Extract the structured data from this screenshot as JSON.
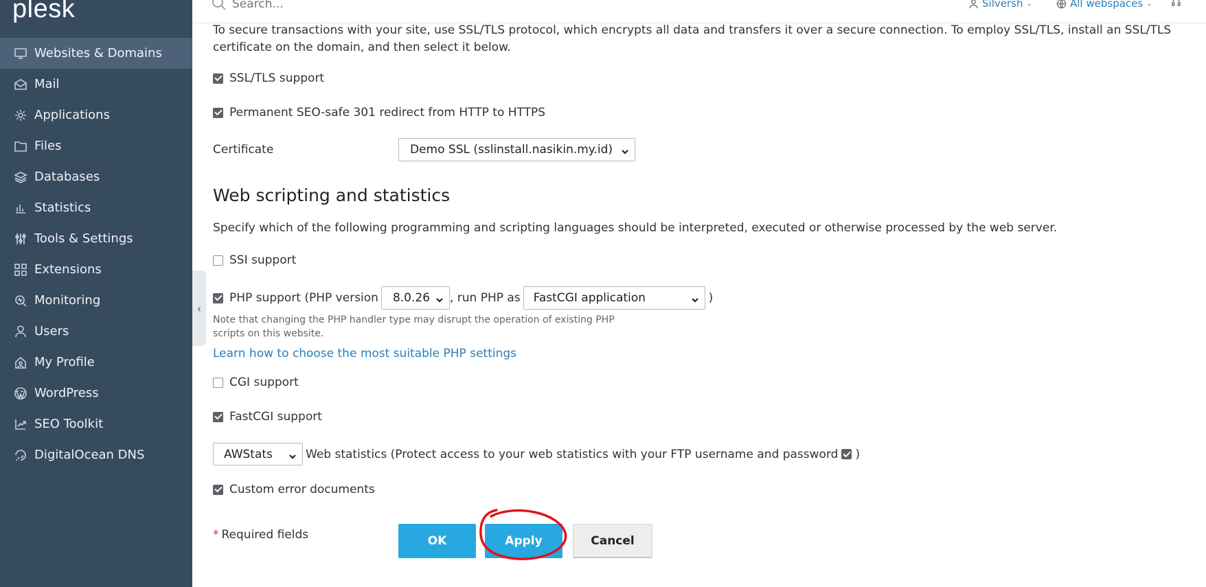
{
  "app": {
    "logo": "plesk"
  },
  "sidebar": {
    "items": [
      {
        "label": "Websites & Domains",
        "icon": "monitor-icon",
        "active": true
      },
      {
        "label": "Mail",
        "icon": "mail-icon"
      },
      {
        "label": "Applications",
        "icon": "gear-icon"
      },
      {
        "label": "Files",
        "icon": "folder-icon"
      },
      {
        "label": "Databases",
        "icon": "database-layers-icon"
      },
      {
        "label": "Statistics",
        "icon": "bar-chart-icon"
      },
      {
        "label": "Tools & Settings",
        "icon": "sliders-icon"
      },
      {
        "label": "Extensions",
        "icon": "extensions-grid-icon"
      },
      {
        "label": "Monitoring",
        "icon": "monitoring-icon"
      },
      {
        "label": "Users",
        "icon": "user-icon"
      },
      {
        "label": "My Profile",
        "icon": "profile-icon"
      },
      {
        "label": "WordPress",
        "icon": "wordpress-icon"
      },
      {
        "label": "SEO Toolkit",
        "icon": "seo-chart-icon"
      },
      {
        "label": "DigitalOcean DNS",
        "icon": "digitalocean-icon"
      }
    ]
  },
  "header": {
    "search_placeholder": "Search...",
    "user": "Silversh",
    "workspaces": "All webspaces"
  },
  "form": {
    "ssl_intro": "To secure transactions with your site, use SSL/TLS protocol, which encrypts all data and transfers it over a secure connection. To employ SSL/TLS, install an SSL/TLS certificate on the domain, and then select it below.",
    "ssl_support": {
      "label": "SSL/TLS support",
      "checked": true
    },
    "redirect": {
      "label": "Permanent SEO-safe 301 redirect from HTTP to HTTPS",
      "checked": true
    },
    "certificate": {
      "label": "Certificate",
      "value": "Demo SSL (sslinstall.nasikin.my.id)"
    },
    "section_title": "Web scripting and statistics",
    "section_desc": "Specify which of the following programming and scripting languages should be interpreted, executed or otherwise processed by the web server.",
    "ssi": {
      "label": "SSI support",
      "checked": false
    },
    "php": {
      "label": "PHP support (PHP version",
      "checked": true,
      "version": "8.0.26",
      "run_as_label": ", run PHP as",
      "handler": "FastCGI application",
      "close": ")",
      "note": "Note that changing the PHP handler type may disrupt the operation of existing PHP scripts on this website.",
      "link": "Learn how to choose the most suitable PHP settings"
    },
    "cgi": {
      "label": "CGI support",
      "checked": false
    },
    "fastcgi": {
      "label": "FastCGI support",
      "checked": true
    },
    "stats": {
      "value": "AWStats",
      "label": "Web statistics (Protect access to your web statistics with your FTP username and password",
      "protect_checked": true,
      "close": ")"
    },
    "error_docs": {
      "label": "Custom error documents",
      "checked": true
    },
    "required_star": "*",
    "required": "Required fields",
    "buttons": {
      "ok": "OK",
      "apply": "Apply",
      "cancel": "Cancel"
    }
  },
  "colors": {
    "sidebar": "#374b5f",
    "primary_button": "#28a8e0",
    "annotation": "#e0141a",
    "link": "#2b7fb8"
  }
}
